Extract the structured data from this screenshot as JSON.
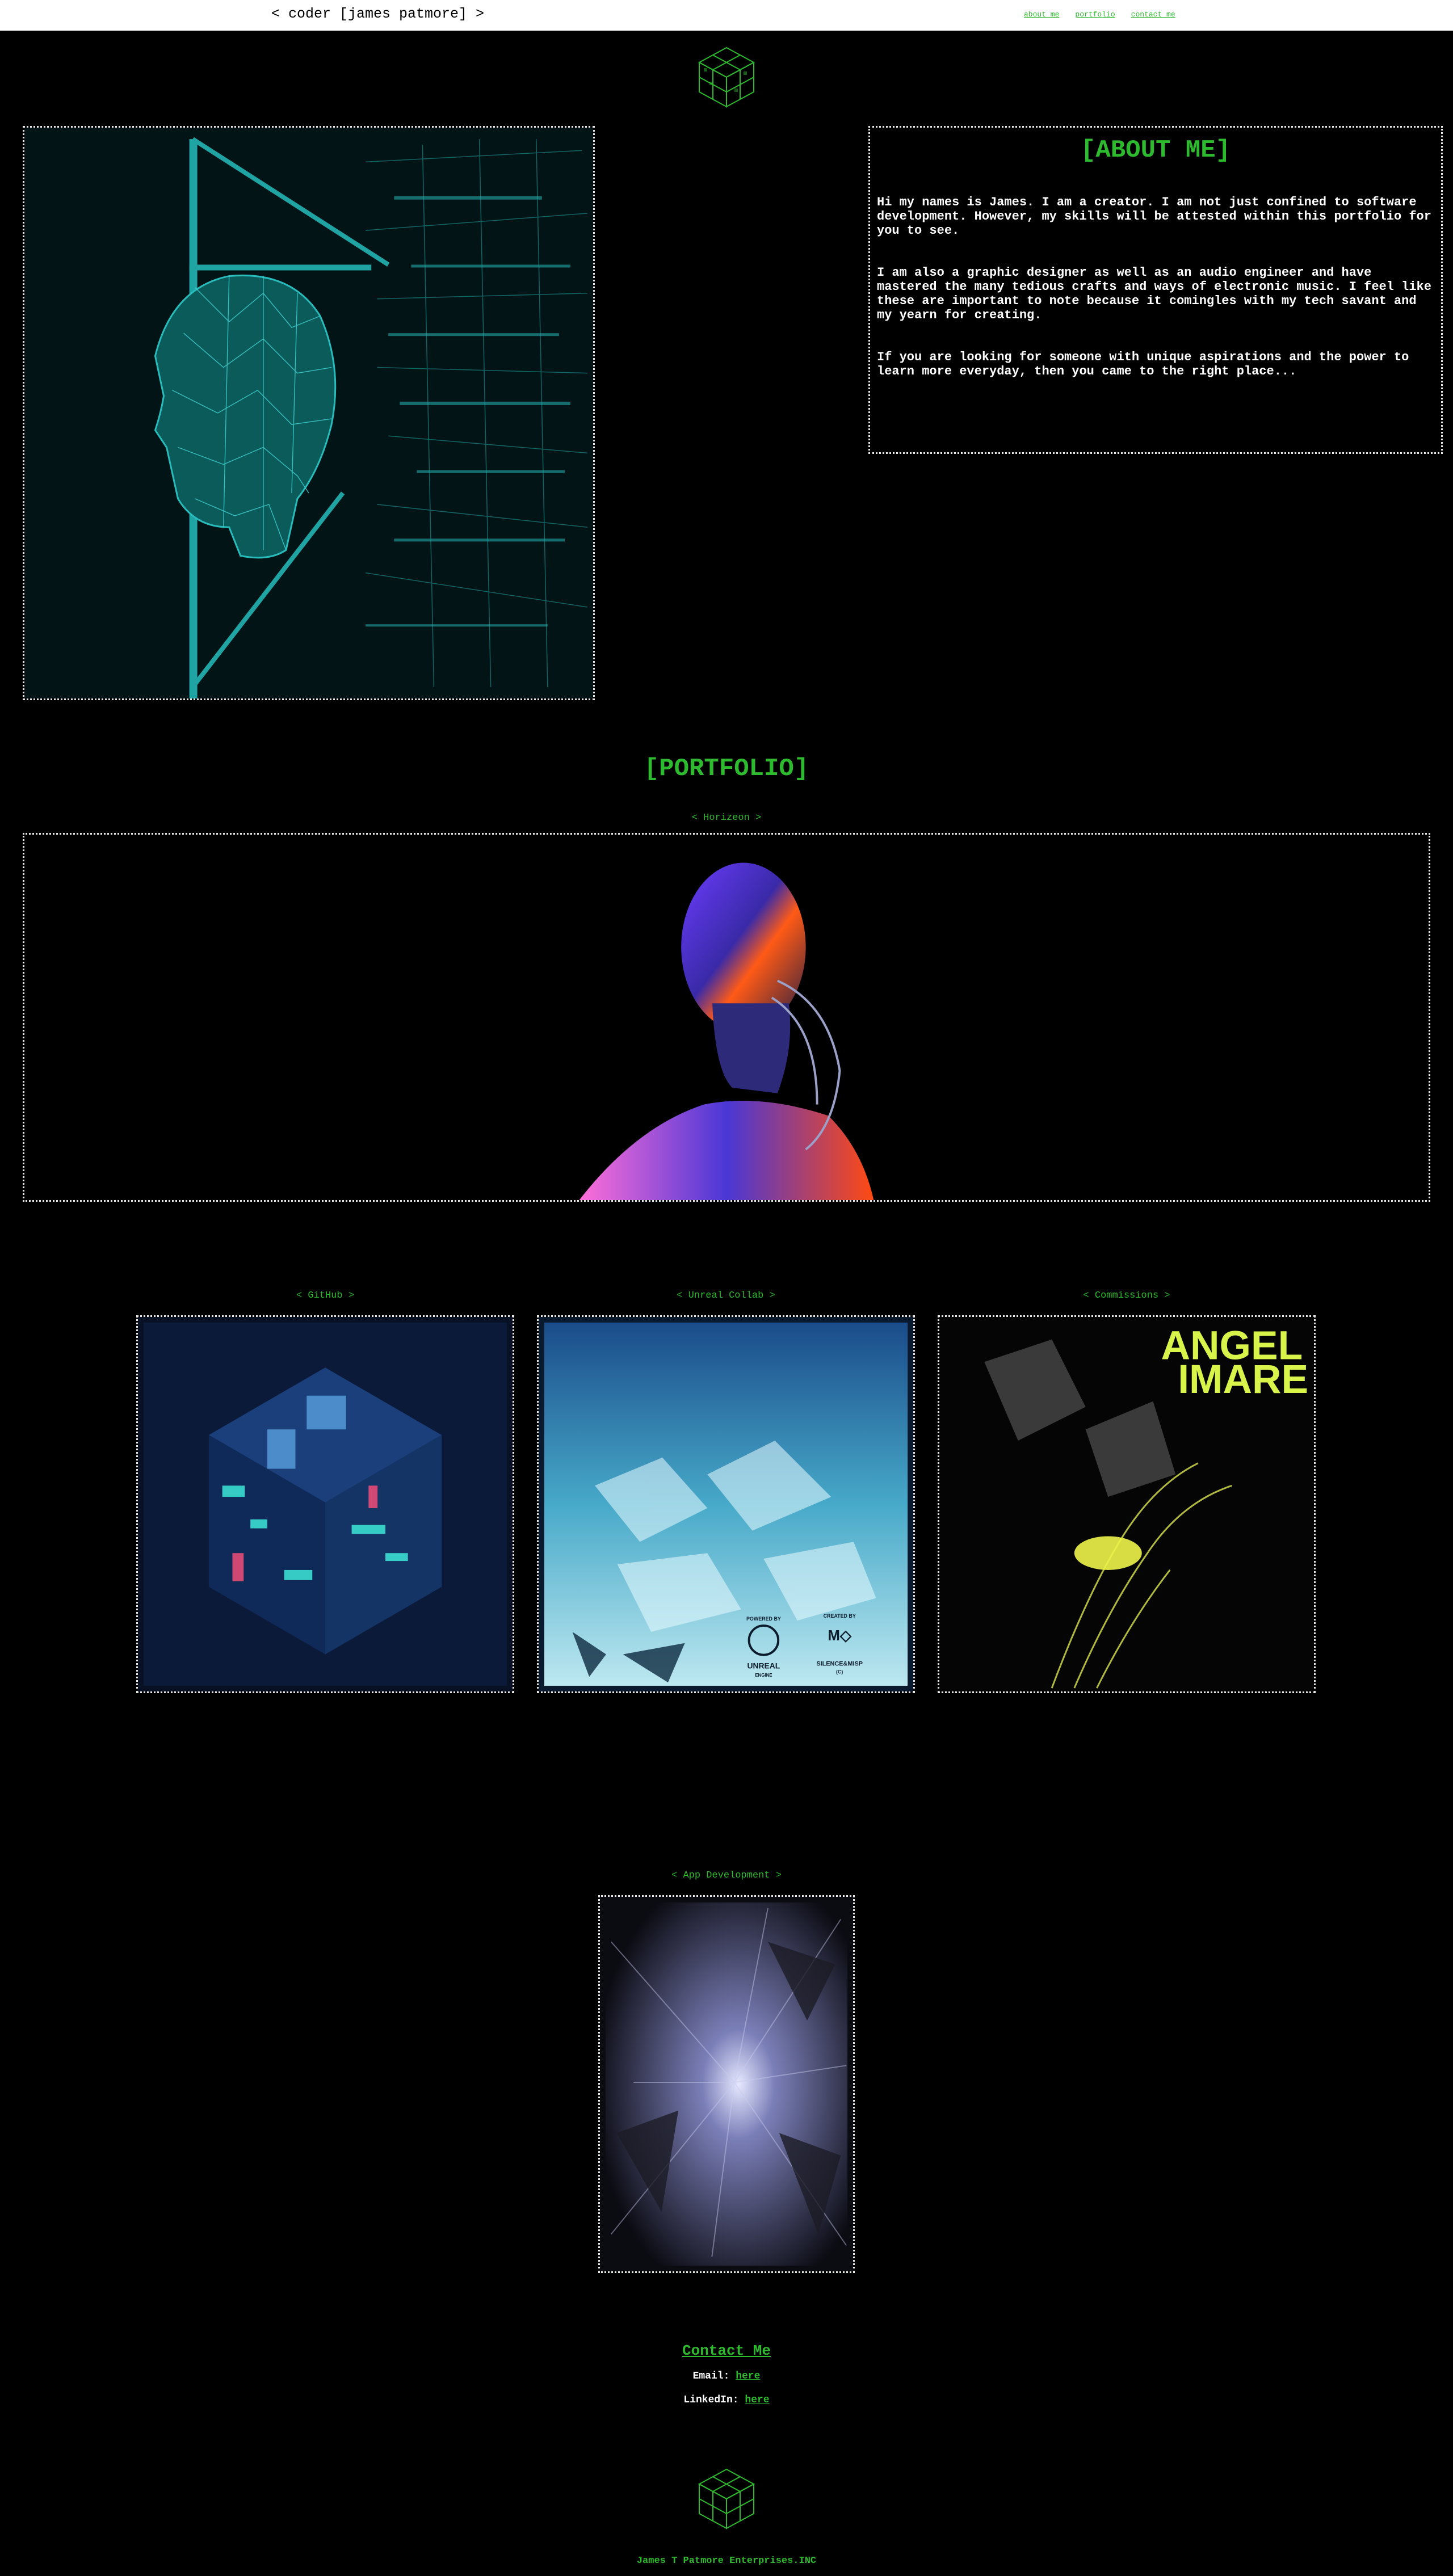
{
  "header": {
    "brand": "< coder [james patmore] >",
    "nav": [
      {
        "label": "about me"
      },
      {
        "label": "portfolio"
      },
      {
        "label": "contact me"
      }
    ]
  },
  "about": {
    "title": "[ABOUT ME]",
    "paragraphs": [
      "Hi my names is James. I am a creator. I am not just confined to software development. However, my skills will be attested within this portfolio for you to see.",
      "I am also a graphic designer as well as an audio engineer and have mastered the many tedious crafts and ways of electronic music. I feel like these are important to note because it comingles with my tech savant and my yearn for creating.",
      "If you are looking for someone with unique aspirations and the power to learn more everyday, then you came to the right place..."
    ]
  },
  "portfolio": {
    "title": "[PORTFOLIO]",
    "featured_caption": "< Horizeon >",
    "items": [
      {
        "caption": "< GitHub >"
      },
      {
        "caption": "< Unreal Collab >"
      },
      {
        "caption": "< Commissions >"
      },
      {
        "caption": "< App Development >"
      }
    ],
    "unreal_art": {
      "powered_by": "POWERED BY",
      "engine_line1": "UNREAL",
      "engine_line2": "ENGINE",
      "created_by": "CREATED BY",
      "studio_line1": "SILENCE&MISP",
      "studio_line2": "(C)"
    },
    "commission_art": {
      "line1": "ANGEL",
      "line2": "IMARE"
    }
  },
  "contact": {
    "title": "Contact Me",
    "email_label": "Email:",
    "email_link": "here",
    "linkedin_label": "LinkedIn:",
    "linkedin_link": "here"
  },
  "footer": {
    "text": "James T Patmore Enterprises.INC"
  },
  "colors": {
    "accent": "#2eba2e",
    "background": "#000000",
    "frame": "#e8e8e8"
  }
}
